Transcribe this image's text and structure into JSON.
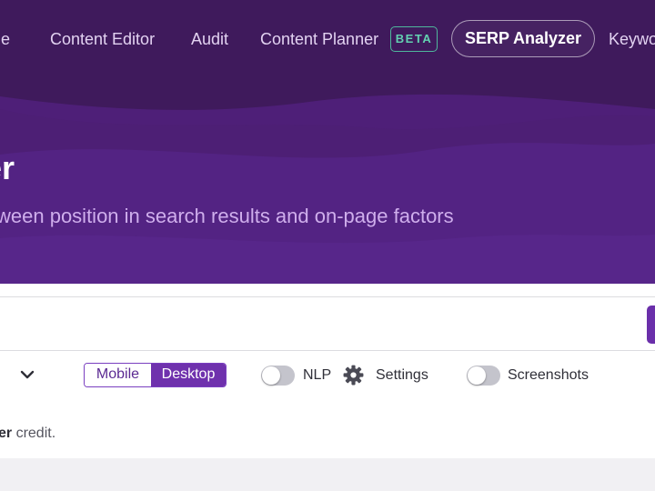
{
  "nav": {
    "items": [
      {
        "label": "me"
      },
      {
        "label": "Content Editor"
      },
      {
        "label": "Audit"
      },
      {
        "label": "Content Planner"
      },
      {
        "label": "SERP Analyzer",
        "active": true
      },
      {
        "label": "Keywo"
      }
    ],
    "beta_badge": "BETA"
  },
  "hero": {
    "title": "er",
    "subtitle": "ween position in search results and on-page factors"
  },
  "controls": {
    "device_options": [
      "Mobile",
      "Desktop"
    ],
    "device_selected": "Desktop",
    "nlp_label": "NLP",
    "nlp_enabled": false,
    "settings_label": "Settings",
    "screenshots_label": "Screenshots",
    "screenshots_enabled": false
  },
  "credit_note": {
    "bold": "zer",
    "text": " credit."
  },
  "icons": {
    "dropdown": "chevron-down-icon",
    "settings": "gear-icon"
  },
  "colors": {
    "hero_bg": "#4e1f78",
    "accent": "#6f31ad",
    "beta": "#63d1b1"
  }
}
